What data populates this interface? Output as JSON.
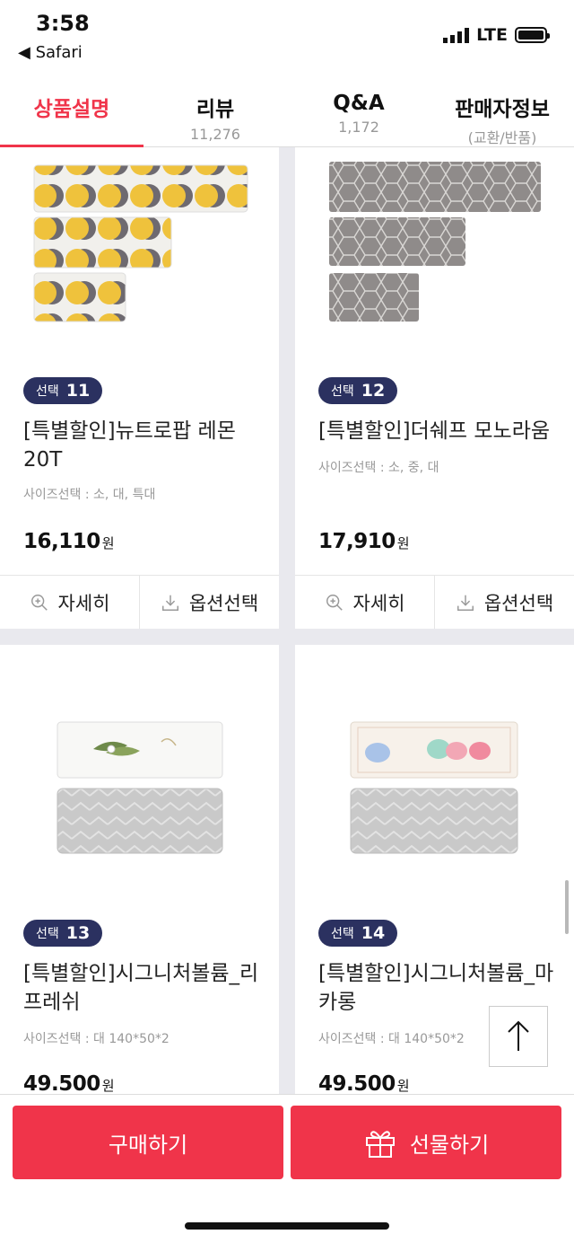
{
  "status": {
    "time": "3:58",
    "back_label": "◀ Safari",
    "network": "LTE"
  },
  "tabs": [
    {
      "title": "상품설명",
      "sub": ""
    },
    {
      "title": "리뷰",
      "sub": "11,276"
    },
    {
      "title": "Q&A",
      "sub": "1,172"
    },
    {
      "title": "판매자정보",
      "sub": "(교환/반품)"
    }
  ],
  "products": [
    {
      "badge_label": "선택",
      "badge_num": "11",
      "name": "[특별할인]뉴트로팝 레몬 20T",
      "size": "사이즈선택 : 소, 대, 특대",
      "price": "16,110",
      "won": "원"
    },
    {
      "badge_label": "선택",
      "badge_num": "12",
      "name": "[특별할인]더쉐프 모노라움",
      "size": "사이즈선택 : 소, 중, 대",
      "price": "17,910",
      "won": "원"
    },
    {
      "badge_label": "선택",
      "badge_num": "13",
      "name": "[특별할인]시그니처볼륨_리프레쉬",
      "size": "사이즈선택 : 대 140*50*2",
      "price": "49.500",
      "won": "원"
    },
    {
      "badge_label": "선택",
      "badge_num": "14",
      "name": "[특별할인]시그니처볼륨_마카롱",
      "size": "사이즈선택 : 대 140*50*2",
      "price": "49.500",
      "won": "원"
    }
  ],
  "actions": {
    "detail": "자세히",
    "option": "옵션선택"
  },
  "buttons": {
    "buy": "구매하기",
    "gift": "선물하기"
  },
  "colors": {
    "accent": "#f0344a",
    "badge": "#2b3160"
  }
}
